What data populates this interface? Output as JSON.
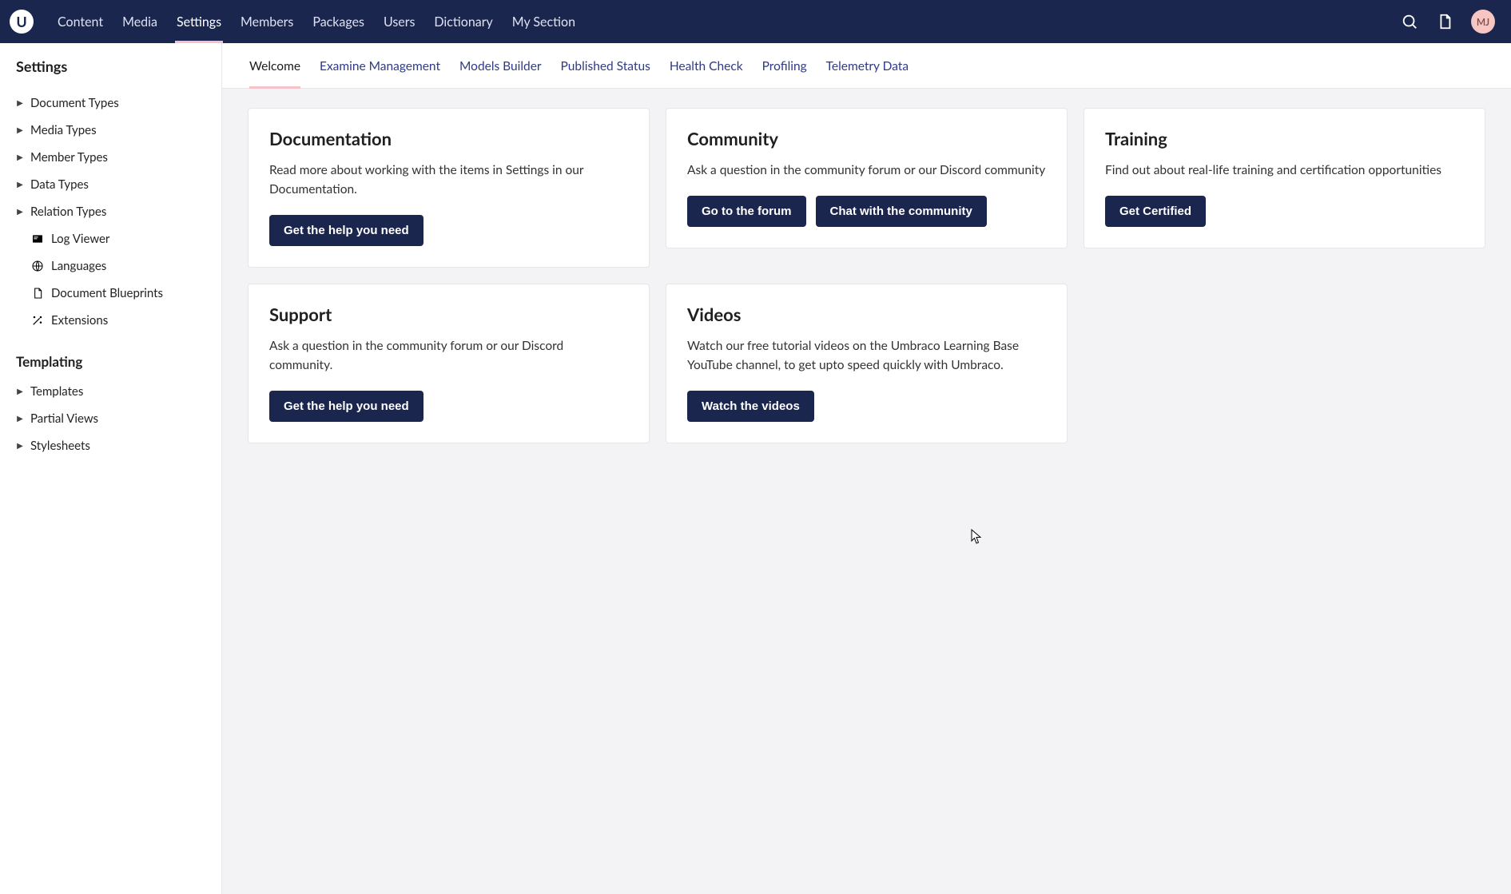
{
  "app": {
    "logo_letter": "U"
  },
  "nav": {
    "items": [
      {
        "label": "Content",
        "name": "nav-content",
        "active": false
      },
      {
        "label": "Media",
        "name": "nav-media",
        "active": false
      },
      {
        "label": "Settings",
        "name": "nav-settings",
        "active": true
      },
      {
        "label": "Members",
        "name": "nav-members",
        "active": false
      },
      {
        "label": "Packages",
        "name": "nav-packages",
        "active": false
      },
      {
        "label": "Users",
        "name": "nav-users",
        "active": false
      },
      {
        "label": "Dictionary",
        "name": "nav-dictionary",
        "active": false
      },
      {
        "label": "My Section",
        "name": "nav-my-section",
        "active": false
      }
    ]
  },
  "user": {
    "initials": "MJ"
  },
  "sidebar": {
    "title": "Settings",
    "sections": [
      {
        "label": "",
        "items": [
          {
            "label": "Document Types",
            "icon": "caret",
            "name": "tree-document-types"
          },
          {
            "label": "Media Types",
            "icon": "caret",
            "name": "tree-media-types"
          },
          {
            "label": "Member Types",
            "icon": "caret",
            "name": "tree-member-types"
          },
          {
            "label": "Data Types",
            "icon": "caret",
            "name": "tree-data-types"
          },
          {
            "label": "Relation Types",
            "icon": "caret",
            "name": "tree-relation-types"
          },
          {
            "label": "Log Viewer",
            "icon": "log",
            "name": "tree-log-viewer"
          },
          {
            "label": "Languages",
            "icon": "globe",
            "name": "tree-languages"
          },
          {
            "label": "Document Blueprints",
            "icon": "doc",
            "name": "tree-document-blueprints"
          },
          {
            "label": "Extensions",
            "icon": "wand",
            "name": "tree-extensions"
          }
        ]
      },
      {
        "label": "Templating",
        "items": [
          {
            "label": "Templates",
            "icon": "caret",
            "name": "tree-templates"
          },
          {
            "label": "Partial Views",
            "icon": "caret",
            "name": "tree-partial-views"
          },
          {
            "label": "Stylesheets",
            "icon": "caret",
            "name": "tree-stylesheets"
          }
        ]
      }
    ]
  },
  "tabs": {
    "items": [
      {
        "label": "Welcome",
        "name": "tab-welcome",
        "active": true
      },
      {
        "label": "Examine Management",
        "name": "tab-examine-management",
        "active": false
      },
      {
        "label": "Models Builder",
        "name": "tab-models-builder",
        "active": false
      },
      {
        "label": "Published Status",
        "name": "tab-published-status",
        "active": false
      },
      {
        "label": "Health Check",
        "name": "tab-health-check",
        "active": false
      },
      {
        "label": "Profiling",
        "name": "tab-profiling",
        "active": false
      },
      {
        "label": "Telemetry Data",
        "name": "tab-telemetry-data",
        "active": false
      }
    ]
  },
  "cards": [
    {
      "name": "card-documentation",
      "title": "Documentation",
      "body": "Read more about working with the items in Settings in our Documentation.",
      "buttons": [
        {
          "label": "Get the help you need",
          "name": "documentation-help-button"
        }
      ]
    },
    {
      "name": "card-community",
      "title": "Community",
      "body": "Ask a question in the community forum or our Discord community",
      "buttons": [
        {
          "label": "Go to the forum",
          "name": "community-forum-button"
        },
        {
          "label": "Chat with the community",
          "name": "community-chat-button"
        }
      ]
    },
    {
      "name": "card-training",
      "title": "Training",
      "body": "Find out about real-life training and certification opportunities",
      "buttons": [
        {
          "label": "Get Certified",
          "name": "training-certified-button"
        }
      ]
    },
    {
      "name": "card-support",
      "title": "Support",
      "body": "Ask a question in the community forum or our Discord community.",
      "buttons": [
        {
          "label": "Get the help you need",
          "name": "support-help-button"
        }
      ]
    },
    {
      "name": "card-videos",
      "title": "Videos",
      "body": "Watch our free tutorial videos on the Umbraco Learning Base YouTube channel, to get upto speed quickly with Umbraco.",
      "buttons": [
        {
          "label": "Watch the videos",
          "name": "videos-watch-button"
        }
      ]
    }
  ]
}
